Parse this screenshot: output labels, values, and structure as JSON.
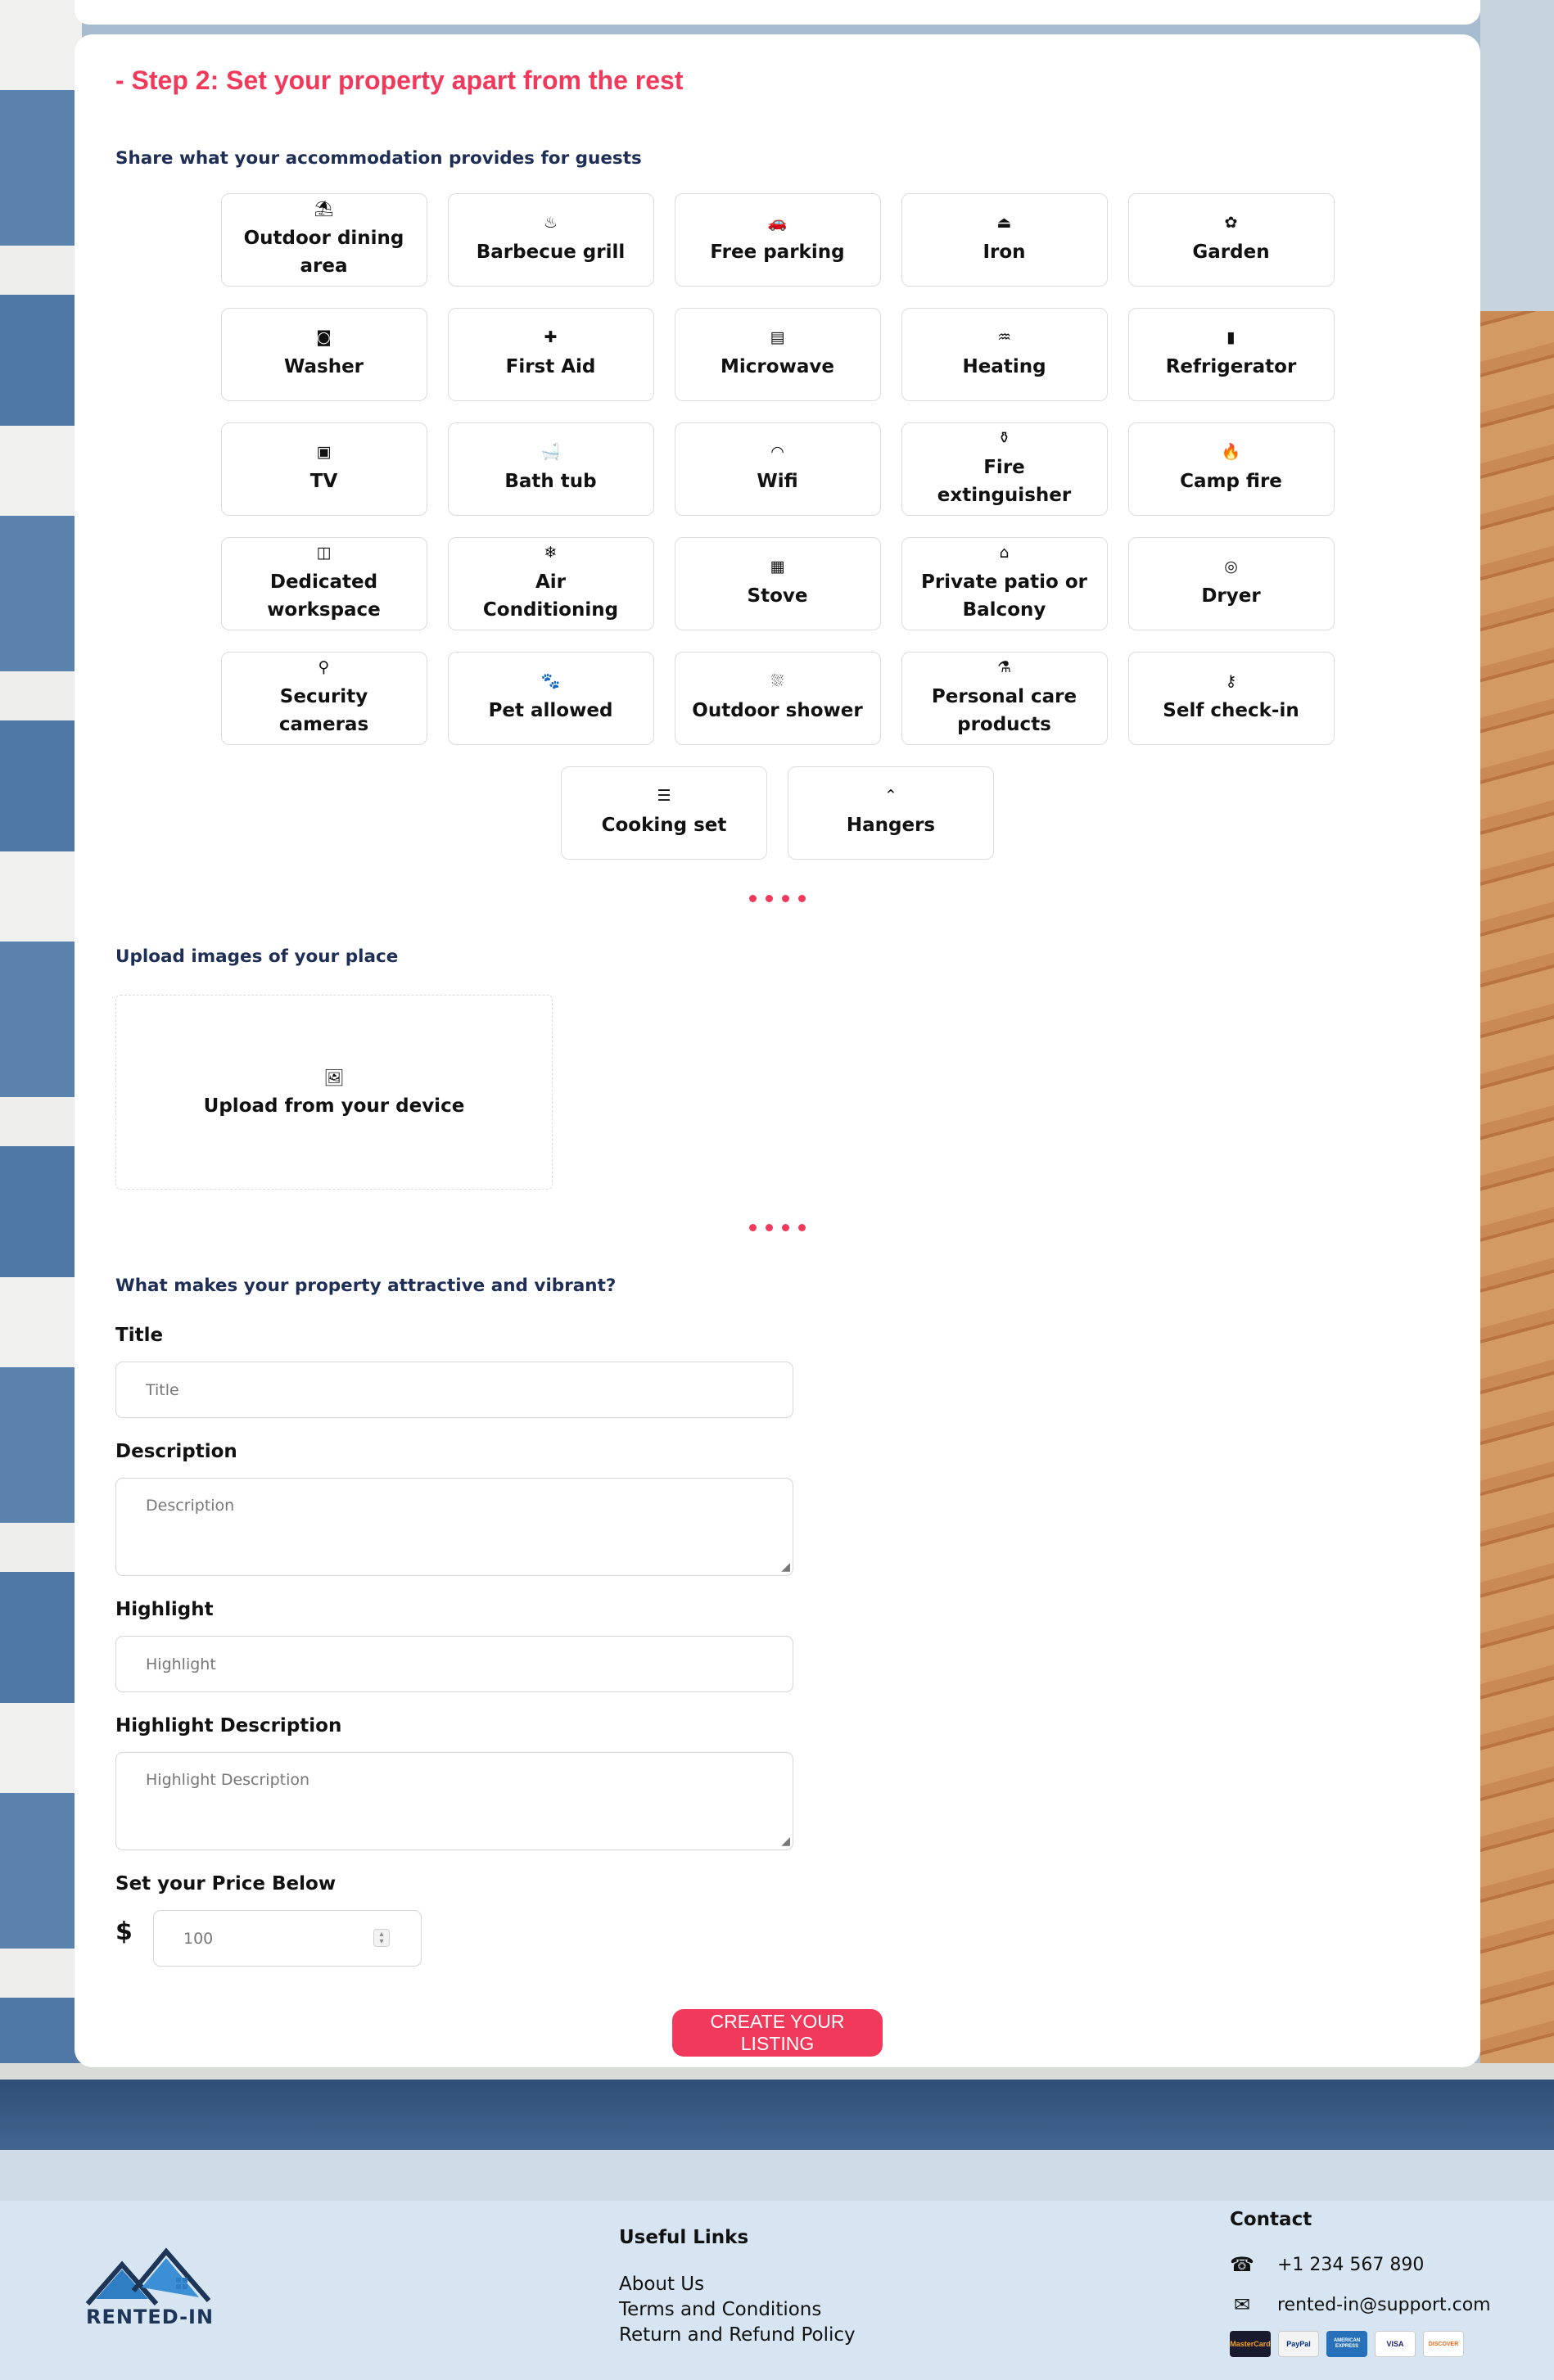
{
  "step": {
    "title": "- Step 2: Set your property apart from the rest"
  },
  "amenities": {
    "heading": "Share what your accommodation provides for guests",
    "rows": [
      [
        {
          "icon": "umbrella-icon",
          "glyph": "⛱",
          "label": "Outdoor dining area"
        },
        {
          "icon": "grill-icon",
          "glyph": "♨",
          "label": "Barbecue grill"
        },
        {
          "icon": "car-icon",
          "glyph": "🚗",
          "label": "Free parking"
        },
        {
          "icon": "iron-icon",
          "glyph": "⏏",
          "label": "Iron"
        },
        {
          "icon": "garden-icon",
          "glyph": "✿",
          "label": "Garden"
        }
      ],
      [
        {
          "icon": "washer-icon",
          "glyph": "◙",
          "label": "Washer"
        },
        {
          "icon": "first-aid-icon",
          "glyph": "✚",
          "label": "First Aid"
        },
        {
          "icon": "microwave-icon",
          "glyph": "▤",
          "label": "Microwave"
        },
        {
          "icon": "heating-icon",
          "glyph": "♒",
          "label": "Heating"
        },
        {
          "icon": "refrigerator-icon",
          "glyph": "▮",
          "label": "Refrigerator"
        }
      ],
      [
        {
          "icon": "tv-icon",
          "glyph": "▣",
          "label": "TV"
        },
        {
          "icon": "bathtub-icon",
          "glyph": "🛁",
          "label": "Bath tub"
        },
        {
          "icon": "wifi-icon",
          "glyph": "◠",
          "label": "Wifi"
        },
        {
          "icon": "fire-extinguisher-icon",
          "glyph": "⚱",
          "label": "Fire extinguisher"
        },
        {
          "icon": "campfire-icon",
          "glyph": "🔥",
          "label": "Camp fire"
        }
      ],
      [
        {
          "icon": "workspace-icon",
          "glyph": "◫",
          "label": "Dedicated workspace"
        },
        {
          "icon": "snowflake-icon",
          "glyph": "❄",
          "label": "Air Conditioning"
        },
        {
          "icon": "stove-icon",
          "glyph": "▦",
          "label": "Stove"
        },
        {
          "icon": "balcony-icon",
          "glyph": "⌂",
          "label": "Private patio or Balcony"
        },
        {
          "icon": "dryer-icon",
          "glyph": "◎",
          "label": "Dryer"
        }
      ],
      [
        {
          "icon": "camera-icon",
          "glyph": "⚲",
          "label": "Security cameras"
        },
        {
          "icon": "paw-icon",
          "glyph": "🐾",
          "label": "Pet allowed"
        },
        {
          "icon": "shower-icon",
          "glyph": "⛆",
          "label": "Outdoor shower"
        },
        {
          "icon": "bottle-icon",
          "glyph": "⚗",
          "label": "Personal care products"
        },
        {
          "icon": "key-icon",
          "glyph": "⚷",
          "label": "Self check-in"
        }
      ],
      [
        {
          "icon": "cooking-set-icon",
          "glyph": "☰",
          "label": "Cooking set"
        },
        {
          "icon": "hanger-icon",
          "glyph": "⌃",
          "label": "Hangers"
        }
      ]
    ]
  },
  "upload": {
    "heading": "Upload images of your place",
    "label": "Upload from your device",
    "icon": "images-icon"
  },
  "details": {
    "heading": "What makes your property attractive and vibrant?",
    "title_label": "Title",
    "title_placeholder": "Title",
    "description_label": "Description",
    "description_placeholder": "Description",
    "highlight_label": "Highlight",
    "highlight_placeholder": "Highlight",
    "highlight_description_label": "Highlight Description",
    "highlight_description_placeholder": "Highlight Description",
    "price_label": "Set your Price Below",
    "currency": "$",
    "price_value": "100"
  },
  "submit_label": "CREATE YOUR LISTING",
  "footer": {
    "brand": "RENTED-IN",
    "useful_links_heading": "Useful Links",
    "links": [
      "About Us",
      "Terms and Conditions",
      "Return and Refund Policy"
    ],
    "contact_heading": "Contact",
    "phone": "+1 234 567 890",
    "email": "rented-in@support.com",
    "payment_cards": [
      "MasterCard",
      "PayPal",
      "AMERICAN EXPRESS",
      "VISA",
      "DISCOVER"
    ]
  },
  "colors": {
    "accent": "#f0395b",
    "heading": "#1e2e55",
    "footer_bg": "#d6e5f1"
  }
}
